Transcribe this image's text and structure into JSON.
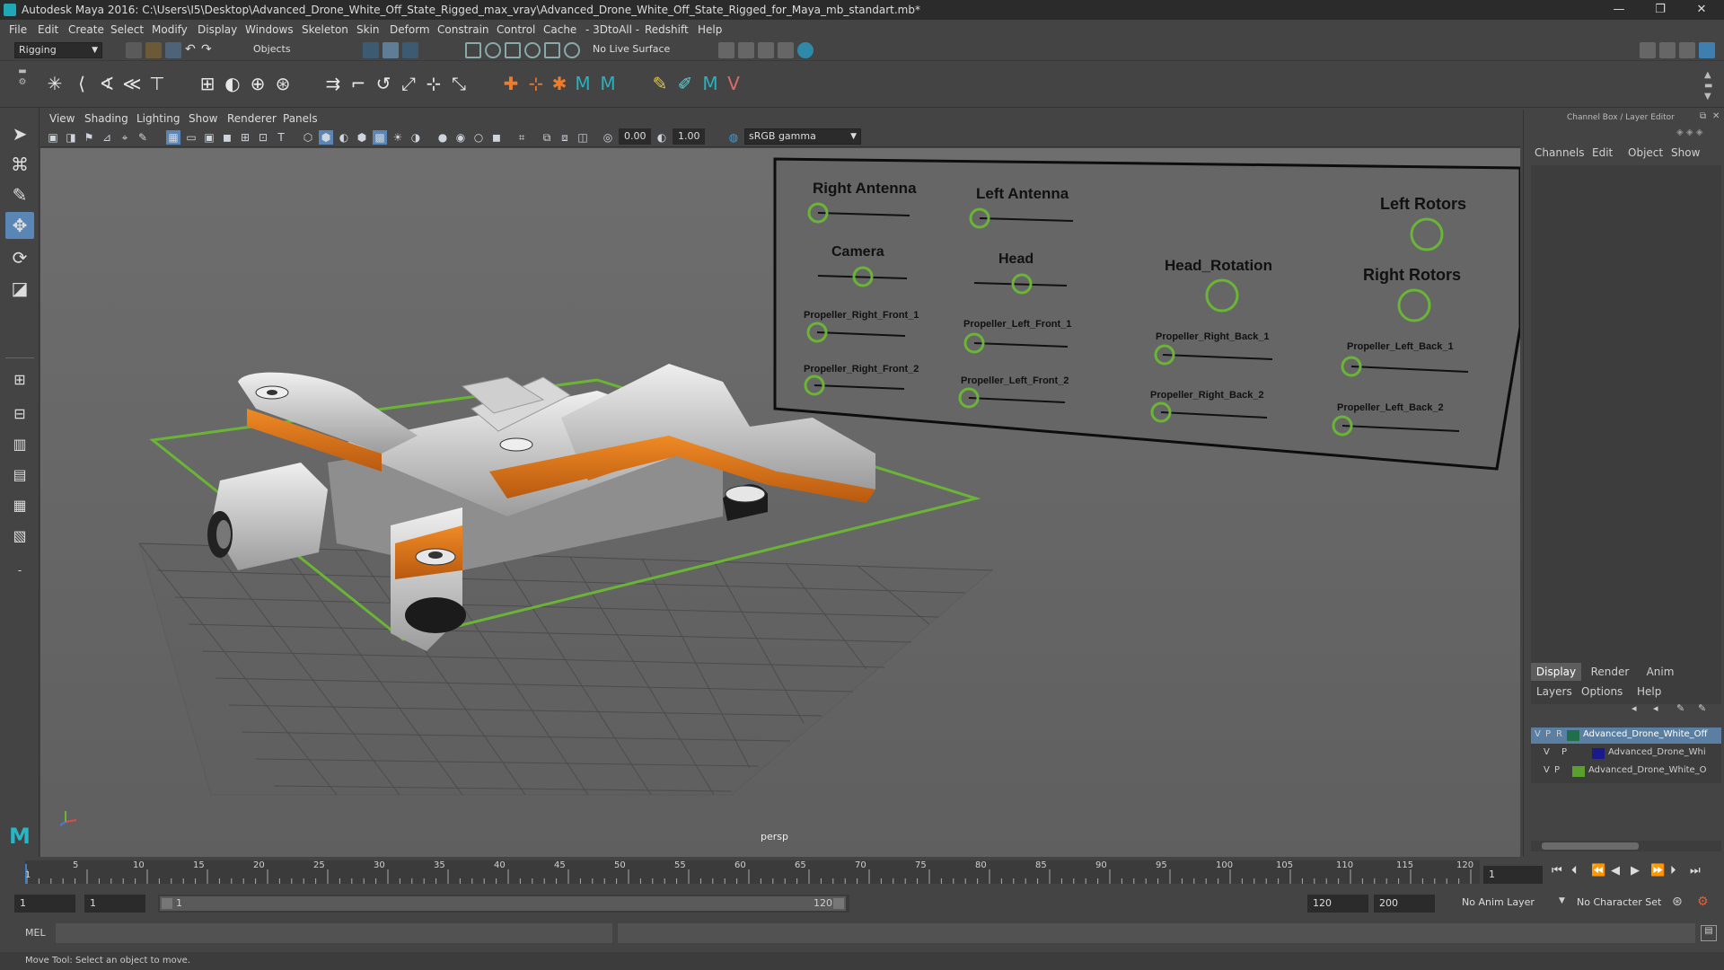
{
  "window": {
    "title": "Autodesk Maya 2016: C:\\Users\\I5\\Desktop\\Advanced_Drone_White_Off_State_Rigged_max_vray\\Advanced_Drone_White_Off_State_Rigged_for_Maya_mb_standart.mb*",
    "minimize": "—",
    "restore": "❐",
    "close": "✕"
  },
  "menubar": [
    "File",
    "Edit",
    "Create",
    "Select",
    "Modify",
    "Display",
    "Windows",
    "Skeleton",
    "Skin",
    "Deform",
    "Constrain",
    "Control",
    "Cache",
    "- 3DtoAll -",
    "Redshift",
    "Help"
  ],
  "status_line": {
    "menu_set": "Rigging",
    "selection_mode": "Objects",
    "live_surface": "No Live Surface"
  },
  "viewport": {
    "menu": [
      "View",
      "Shading",
      "Lighting",
      "Show",
      "Renderer",
      "Panels"
    ],
    "exposure": "0.00",
    "gamma": "1.00",
    "color_space": "sRGB gamma",
    "camera_label": "persp"
  },
  "rig_board": {
    "labels": {
      "right_antenna": "Right Antenna",
      "left_antenna": "Left Antenna",
      "left_rotors": "Left Rotors",
      "camera": "Camera",
      "head": "Head",
      "head_rotation": "Head_Rotation",
      "right_rotors": "Right Rotors",
      "prop_rf1": "Propeller_Right_Front_1",
      "prop_lf1": "Propeller_Left_Front_1",
      "prop_rb1": "Propeller_Right_Back_1",
      "prop_lb1": "Propeller_Left_Back_1",
      "prop_rf2": "Propeller_Right_Front_2",
      "prop_lf2": "Propeller_Left_Front_2",
      "prop_rb2": "Propeller_Right_Back_2",
      "prop_lb2": "Propeller_Left_Back_2"
    }
  },
  "channel_box": {
    "title": "Channel Box / Layer Editor",
    "menu": [
      "Channels",
      "Edit",
      "Object",
      "Show"
    ],
    "tabs": [
      "Display",
      "Render",
      "Anim"
    ],
    "layer_menu": [
      "Layers",
      "Options",
      "Help"
    ],
    "layers": [
      {
        "v": "V",
        "p": "P",
        "r": "R",
        "name": "Advanced_Drone_White_Off",
        "color": "#1f6f4a",
        "selected": true
      },
      {
        "v": "V",
        "p": "P",
        "r": "",
        "name": "Advanced_Drone_Whi",
        "color": "#1a1a8a",
        "selected": false
      },
      {
        "v": "V",
        "p": "P",
        "r": "",
        "name": "Advanced_Drone_White_O",
        "color": "#59a02c",
        "selected": false
      }
    ]
  },
  "timeline": {
    "ticks": [
      "5",
      "10",
      "15",
      "20",
      "25",
      "30",
      "35",
      "40",
      "45",
      "50",
      "55",
      "60",
      "65",
      "70",
      "75",
      "80",
      "85",
      "90",
      "95",
      "100",
      "105",
      "110",
      "115",
      "120"
    ],
    "start_tick": "1",
    "current_frame": "1"
  },
  "range": {
    "start": "1",
    "playback_start": "1",
    "slider_start": "1",
    "slider_end": "120",
    "playback_end": "120",
    "end": "200",
    "anim_layer": "No Anim Layer",
    "character_set": "No Character Set"
  },
  "command_line": {
    "label": "MEL"
  },
  "help_line": {
    "text": "Move Tool: Select an object to move."
  }
}
